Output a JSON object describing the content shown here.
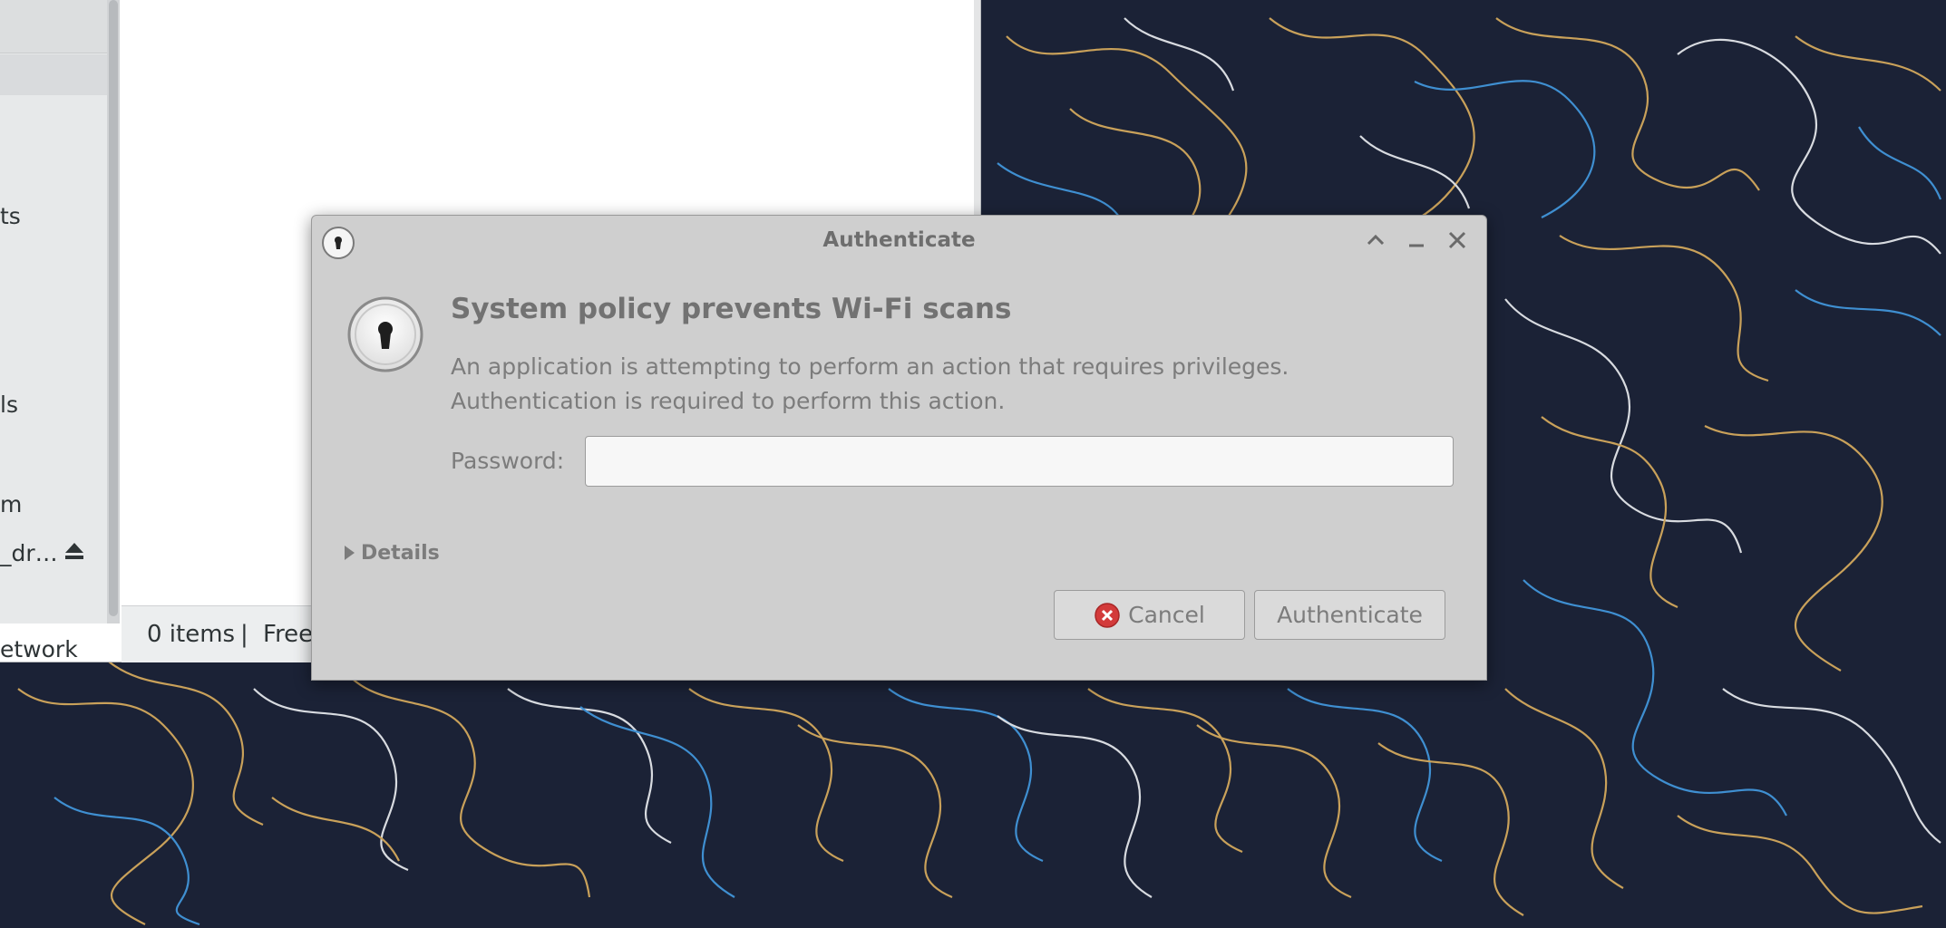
{
  "file_manager": {
    "sidebar_items": [
      "ts",
      "ls",
      "m",
      "_dr…",
      "etwork"
    ],
    "status_items": "0 items",
    "status_separator": "|",
    "status_free": "Free"
  },
  "dialog": {
    "title": "Authenticate",
    "heading": "System policy prevents Wi-Fi scans",
    "message": "An application is attempting to perform an action that requires privileges. Authentication is required to perform this action.",
    "password_label": "Password:",
    "password_value": "",
    "details_label": "Details",
    "cancel_label": "Cancel",
    "authenticate_label": "Authenticate"
  },
  "icons": {
    "title": "lock-icon",
    "dialog": "keyhole-lock-icon",
    "cancel": "cancel-circle-icon",
    "eject": "eject-icon"
  },
  "colors": {
    "desktop_bg": "#1b2236",
    "dialog_bg": "#cfcfcf",
    "cancel_icon": "#d33a3a"
  }
}
